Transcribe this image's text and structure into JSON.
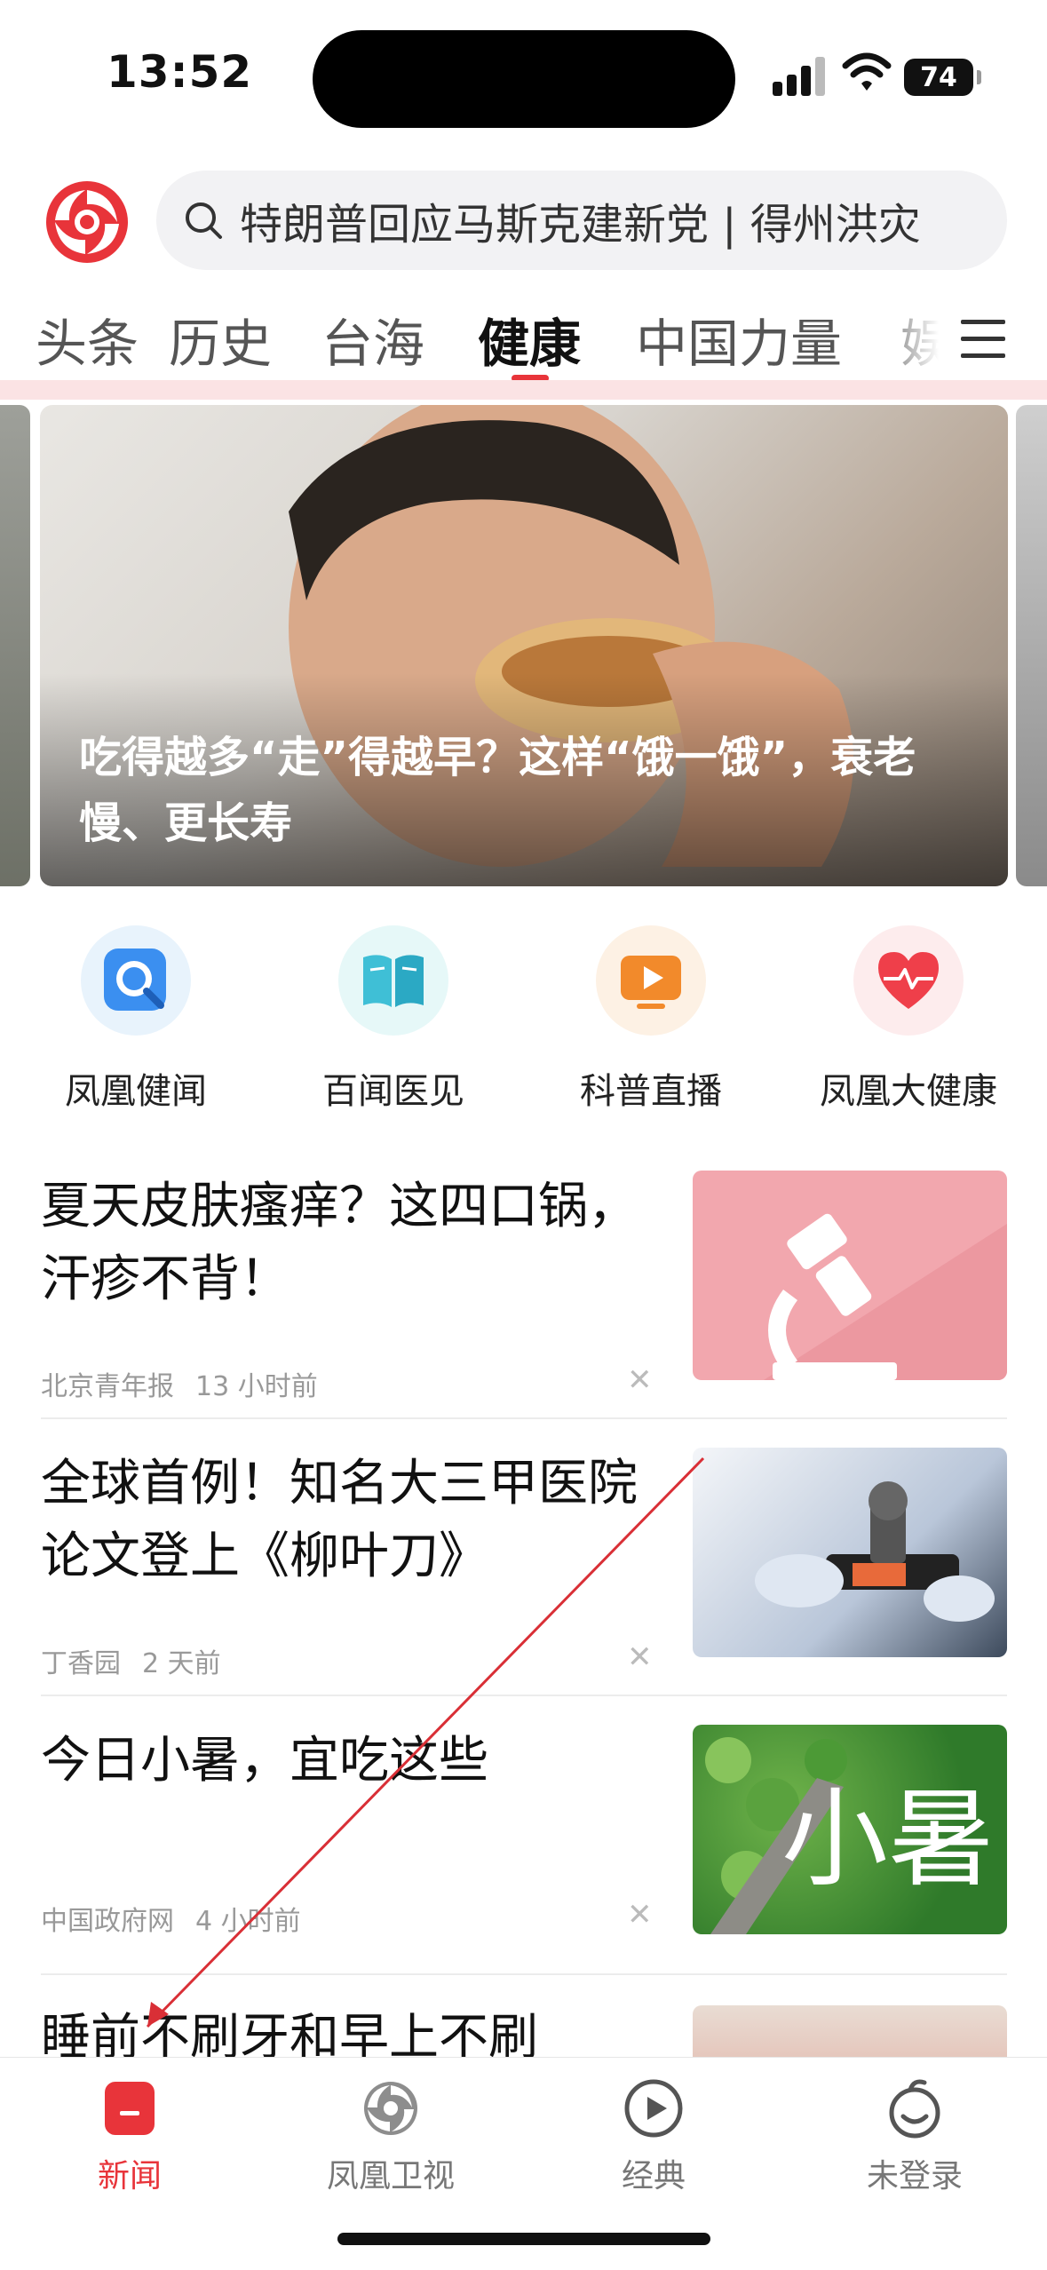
{
  "status_bar": {
    "time": "13:52",
    "battery": "74"
  },
  "search": {
    "text": "特朗普回应马斯克建新党 | 得州洪灾"
  },
  "tabs": [
    "头条",
    "历史",
    "台海",
    "健康",
    "中国力量",
    "娱"
  ],
  "active_tab": "健康",
  "banner": {
    "caption": "吃得越多“走”得越早？这样“饿一饿”，衰老慢、更长寿"
  },
  "shortcuts": [
    {
      "label": "凤凰健闻",
      "icon": "search-magnifier-icon"
    },
    {
      "label": "百闻医见",
      "icon": "open-book-icon"
    },
    {
      "label": "科普直播",
      "icon": "play-tv-icon"
    },
    {
      "label": "凤凰大健康",
      "icon": "heart-pulse-icon"
    }
  ],
  "news": [
    {
      "title": "夏天皮肤瘙痒？这四口锅，汗疹不背！",
      "source": "北京青年报",
      "time": "13 小时前"
    },
    {
      "title": "全球首例！知名大三甲医院论文登上《柳叶刀》",
      "source": "丁香园",
      "time": "2 天前"
    },
    {
      "title": "今日小暑，宜吃这些",
      "source": "中国政府网",
      "time": "4 小时前"
    },
    {
      "title": "睡前不刷牙和早上不刷"
    }
  ],
  "thumb_text": {
    "xiaoshu": "小暑"
  },
  "bottom_nav": [
    {
      "label": "新闻",
      "active": true
    },
    {
      "label": "凤凰卫视",
      "active": false
    },
    {
      "label": "经典",
      "active": false
    },
    {
      "label": "未登录",
      "active": false
    }
  ],
  "colors": {
    "accent": "#e8343a",
    "search_bg": "#f2f2f4",
    "meta": "#999999"
  }
}
